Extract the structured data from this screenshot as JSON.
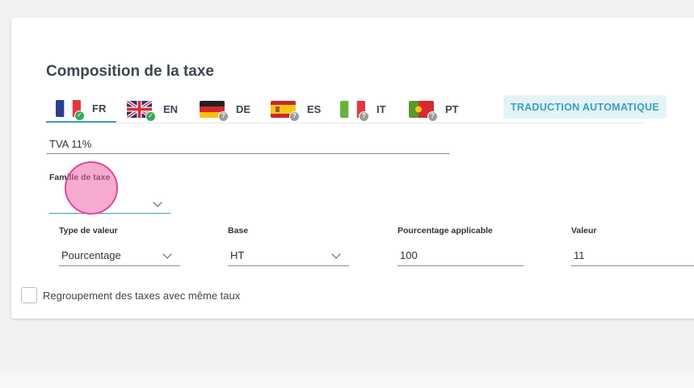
{
  "section": {
    "title": "Composition de la taxe"
  },
  "languages": [
    {
      "code": "FR",
      "status": "translated",
      "active": true
    },
    {
      "code": "EN",
      "status": "translated",
      "active": false
    },
    {
      "code": "DE",
      "status": "missing",
      "active": false
    },
    {
      "code": "ES",
      "status": "missing",
      "active": false
    },
    {
      "code": "IT",
      "status": "missing",
      "active": false
    },
    {
      "code": "PT",
      "status": "missing",
      "active": false
    }
  ],
  "badges": {
    "ok": "✓",
    "missing": "?"
  },
  "auto_translate_label": "TRADUCTION AUTOMATIQUE",
  "tax_name": {
    "value": "TVA 11%"
  },
  "famille": {
    "label": "Famille de taxe",
    "value": ""
  },
  "columns": {
    "type_valeur": {
      "label": "Type de valeur",
      "value": "Pourcentage"
    },
    "base": {
      "label": "Base",
      "value": "HT"
    },
    "pourcentage": {
      "label": "Pourcentage applicable",
      "value": "100"
    },
    "valeur": {
      "label": "Valeur",
      "value": "11"
    }
  },
  "grouping": {
    "label": "Regroupement des taxes avec même taux",
    "checked": false
  },
  "colors": {
    "accent": "#3a9fc0",
    "auto_btn_bg": "#e3f3f8",
    "ok": "#3aa757",
    "missing": "#9a9a9a",
    "cursor": "#e0489a"
  }
}
